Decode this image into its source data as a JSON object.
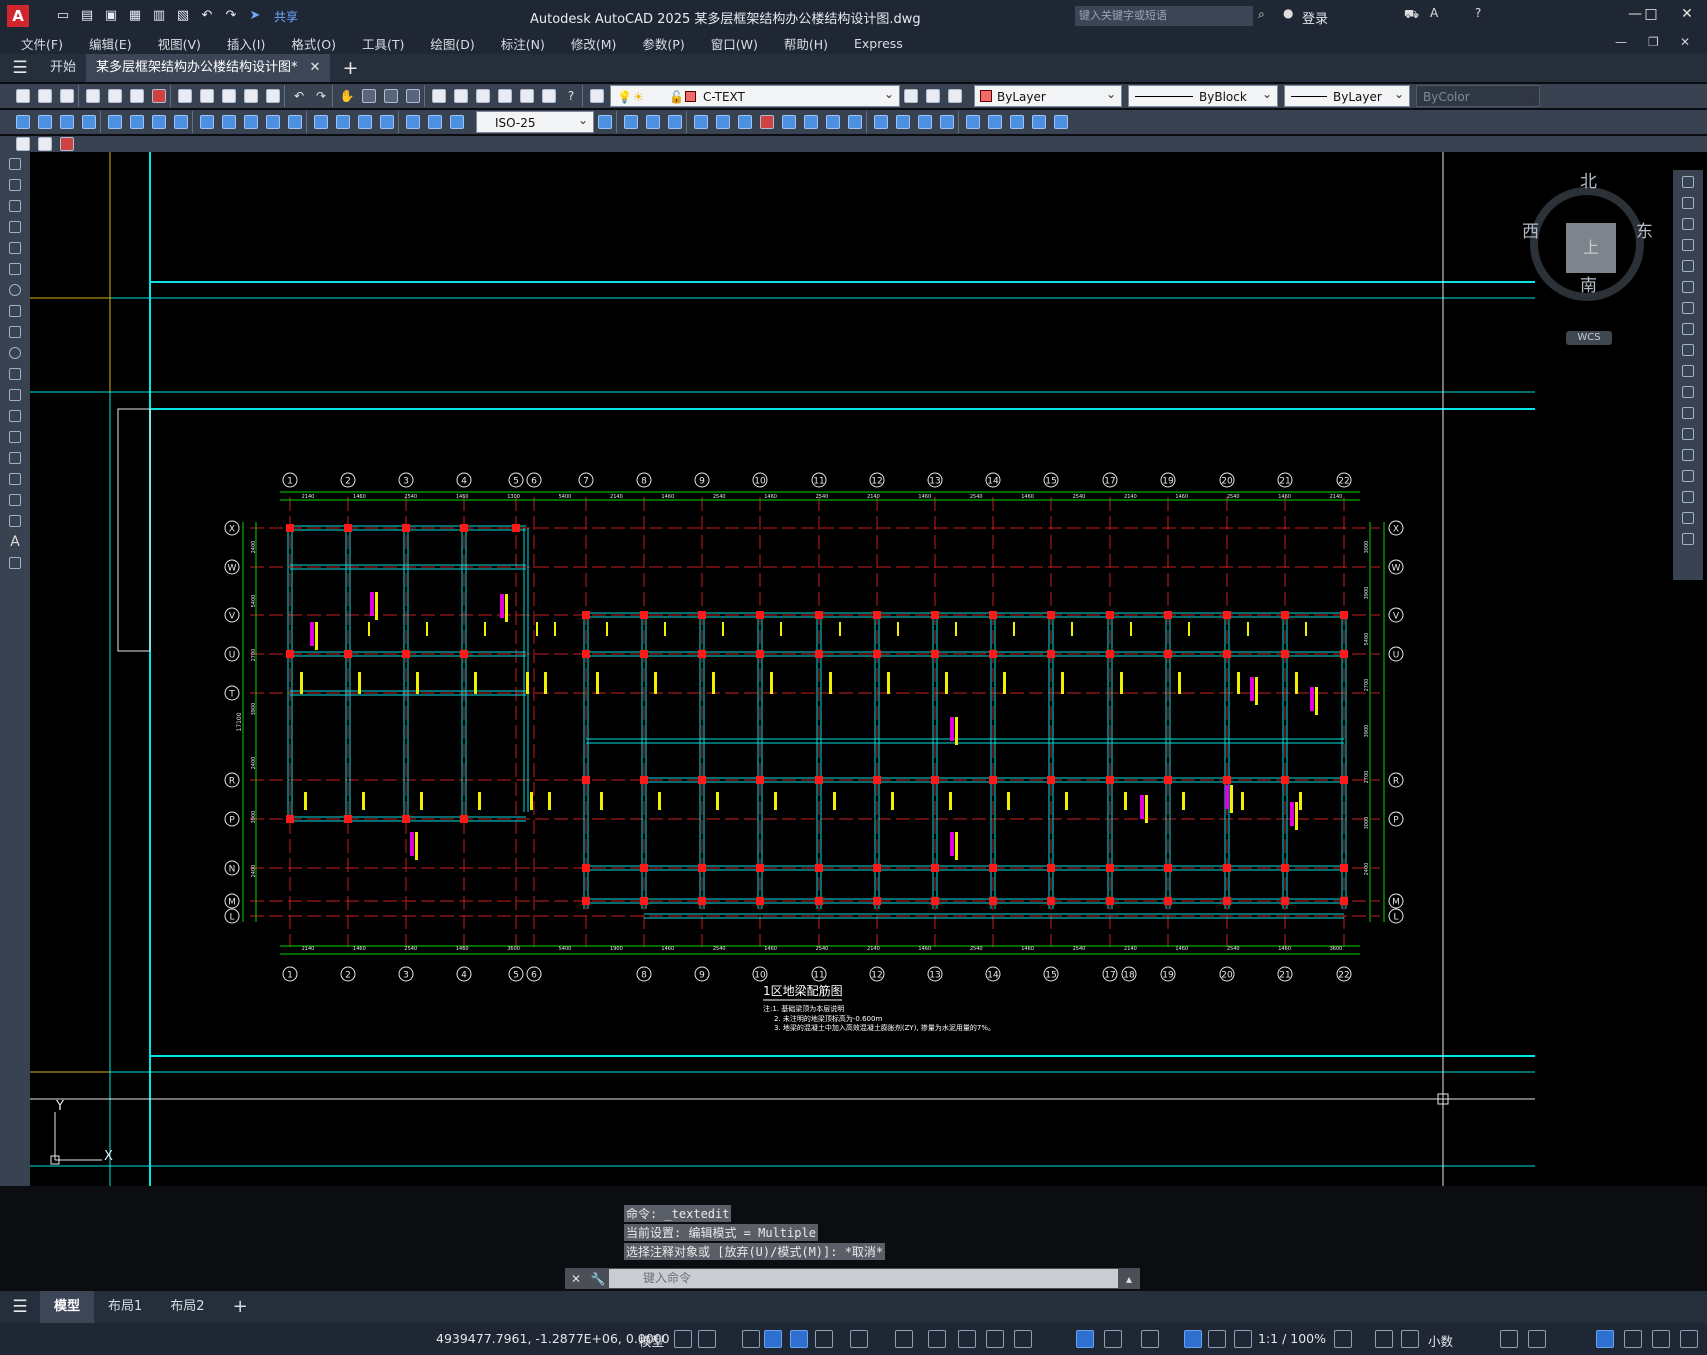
{
  "app": {
    "logo_letter": "A",
    "title": "Autodesk AutoCAD 2025    某多层框架结构办公楼结构设计图.dwg",
    "share_label": "共享",
    "search_placeholder": "键入关键字或短语",
    "login_label": "登录"
  },
  "menu": [
    "文件(F)",
    "编辑(E)",
    "视图(V)",
    "插入(I)",
    "格式(O)",
    "工具(T)",
    "绘图(D)",
    "标注(N)",
    "修改(M)",
    "参数(P)",
    "窗口(W)",
    "帮助(H)",
    "Express"
  ],
  "tabs": [
    {
      "label": "开始"
    },
    {
      "label": "某多层框架结构办公楼结构设计图*"
    }
  ],
  "toolbar": {
    "layer": "C-TEXT",
    "color": "ByLayer",
    "linetype": "ByBlock",
    "lineweight": "ByLayer",
    "plotstyle": "ByColor",
    "dimstyle": "ISO-25"
  },
  "compass": {
    "north": "北",
    "south": "南",
    "east": "东",
    "west": "西",
    "face": "上",
    "ucs": "WCS"
  },
  "drawing": {
    "grid_cols": [
      "1",
      "2",
      "3",
      "4",
      "5",
      "6",
      "7",
      "8",
      "9",
      "10",
      "11",
      "12",
      "13",
      "14",
      "15",
      "17",
      "19",
      "20",
      "21",
      "22"
    ],
    "grid_cols_bottom": [
      "1",
      "2",
      "3",
      "4",
      "5",
      "6",
      "8",
      "9",
      "10",
      "11",
      "12",
      "13",
      "14",
      "15",
      "17",
      "18",
      "19",
      "20",
      "21",
      "22"
    ],
    "grid_rows": [
      "X",
      "W",
      "V",
      "U",
      "T",
      "R",
      "P",
      "N",
      "M",
      "L"
    ],
    "drawing_title": "1区地梁配筋图",
    "notes": [
      "注:1. 基础梁顶为本层说明",
      "2. 未注明的地梁顶标高为-0.600m",
      "3. 地梁的混凝土中加入高效混凝土膨胀剂(ZY), 掺量为水泥用量的7%。"
    ],
    "top_dims": [
      "2140",
      "1460",
      "2540",
      "1460",
      "1300",
      "5400",
      "2140",
      "1460",
      "2540",
      "1460",
      "2540",
      "2140",
      "1460",
      "2540",
      "1460",
      "2540",
      "2140",
      "1460",
      "2540",
      "1460",
      "2140"
    ],
    "bottom_dims": [
      "2140",
      "1460",
      "2540",
      "1460",
      "3600",
      "5400",
      "1900",
      "1460",
      "2540",
      "1460",
      "2540",
      "2140",
      "1460",
      "2540",
      "1460",
      "2540",
      "2140",
      "1460",
      "2540",
      "1460",
      "3600"
    ],
    "right_dims": [
      "3000",
      "3900",
      "5400",
      "2700",
      "3900",
      "2700",
      "3000",
      "2400"
    ],
    "left_dims": [
      "2400",
      "5400",
      "2700",
      "3900",
      "2400",
      "3900",
      "2400"
    ],
    "left_total": "17100"
  },
  "command": {
    "history": [
      "命令: _textedit",
      "当前设置: 编辑模式 = Multiple",
      "选择注释对象或 [放弃(U)/模式(M)]: *取消*"
    ],
    "placeholder": "键入命令"
  },
  "layout_tabs": [
    "模型",
    "布局1",
    "布局2"
  ],
  "status": {
    "coords": "4939477.7961, -1.2877E+06, 0.0000",
    "model": "模型",
    "scale": "1:1 / 100%",
    "units": "小数"
  }
}
